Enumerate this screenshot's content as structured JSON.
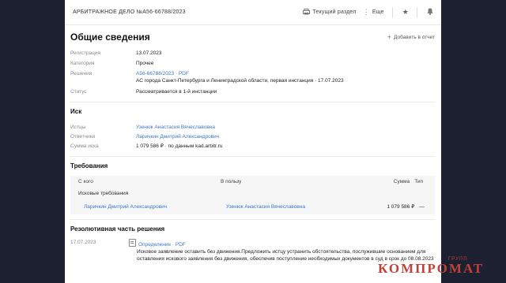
{
  "topbar": {
    "case_title": "АРБИТРАЖНОЕ ДЕЛО №А56-66788/2023",
    "current_section_label": "Текущий раздел",
    "more_label": "Еще"
  },
  "header": {
    "title": "Общие сведения",
    "add_report_label": "Добавить в отчет"
  },
  "general": {
    "registration": {
      "label": "Регистрация",
      "value": "13.07.2023"
    },
    "category": {
      "label": "Категория",
      "value": "Прочее"
    },
    "decisions": {
      "label": "Решения",
      "link": "А56-66788/2023 · PDF",
      "detail": "АС города Санкт-Петербурга и Ленинградской области, первая инстанция · 17.07.2023"
    },
    "status": {
      "label": "Статус",
      "value": "Рассматривается в 1-й инстанции"
    }
  },
  "claim": {
    "title": "Иск",
    "plaintiffs": {
      "label": "Истцы",
      "value": "Узенюк Анастасия Вячеславовна"
    },
    "defendants": {
      "label": "Ответчики",
      "value": "Ларичкин Дмитрий Александрович"
    },
    "amount": {
      "label": "Сумма иска",
      "value": "1 079 586 ₽",
      "source": "по данным kad.arbitr.ru"
    }
  },
  "requirements": {
    "title": "Требования",
    "headers": {
      "from": "С кого",
      "to": "В пользу",
      "sum": "Сумма",
      "type": "Тип"
    },
    "subheader": "Исковые требования",
    "rows": [
      {
        "from": "Ларичкин Дмитрий Александрович",
        "to": "Узенюк Анастасия Вячеславовна",
        "sum": "1 079 586 ₽",
        "type": "—"
      }
    ]
  },
  "resolution": {
    "title": "Резолютивная часть решения",
    "date": "17.07.2023",
    "doc_link": "Определение · PDF",
    "text_line1": "Исковое заявление оставить без движения.Предложить истцу устранить обстоятельства, послужившие основанием для",
    "text_line2": "оставления искового заявления без движения, обеспечив поступление необходимых документов в суд в срок до 08.08.2023"
  },
  "watermark": {
    "small": "ГРУПП",
    "big": "КОМПРОМАТ"
  },
  "colors": {
    "link": "#3e78c4",
    "watermark": "#c0413a",
    "backdrop": "#1d2030"
  },
  "icons": [
    "print-icon",
    "more-icon",
    "star-icon",
    "bell-icon",
    "plus-icon",
    "document-icon"
  ]
}
